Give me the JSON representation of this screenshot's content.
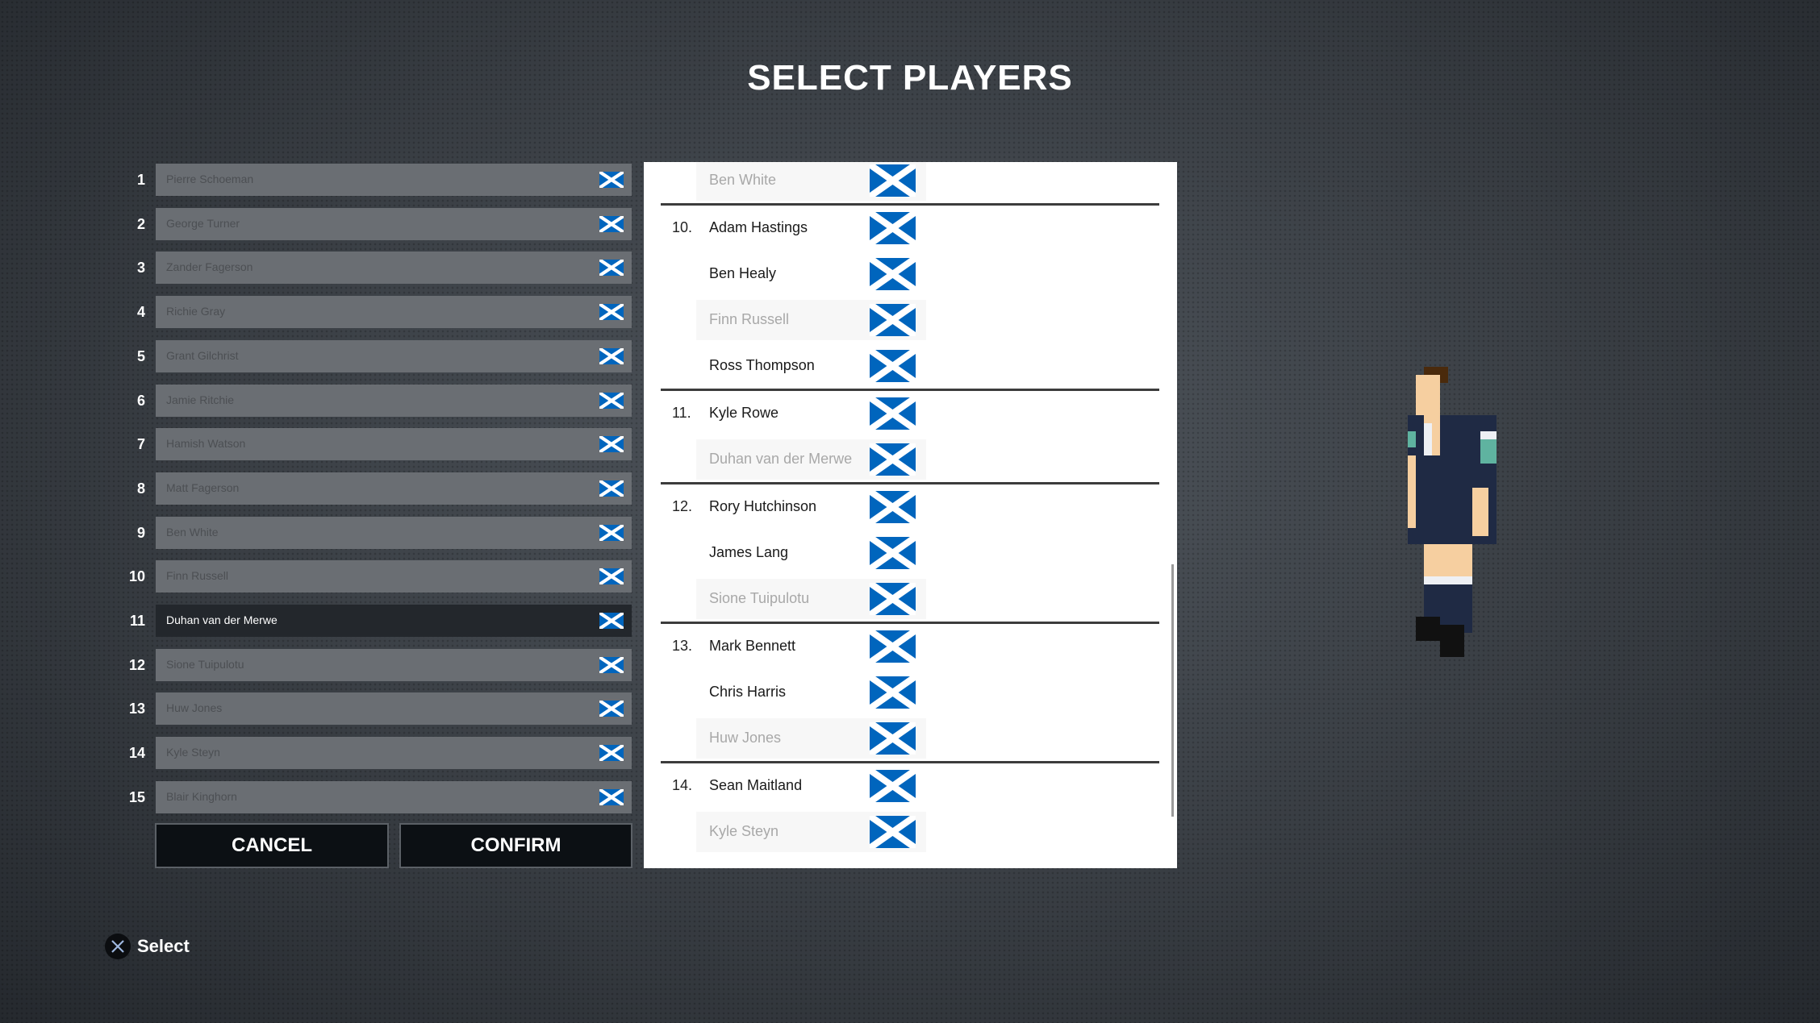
{
  "title": "SELECT PLAYERS",
  "colors": {
    "flag_blue": "#0065bd",
    "selected_slot": "#23272c",
    "slot": "#6a6e73"
  },
  "flag_icon": "scotland-saltire-flag",
  "slots": [
    {
      "number": "1",
      "name": "Pierre Schoeman",
      "selected": false
    },
    {
      "number": "2",
      "name": "George Turner",
      "selected": false
    },
    {
      "number": "3",
      "name": "Zander Fagerson",
      "selected": false
    },
    {
      "number": "4",
      "name": "Richie Gray",
      "selected": false
    },
    {
      "number": "5",
      "name": "Grant Gilchrist",
      "selected": false
    },
    {
      "number": "6",
      "name": "Jamie Ritchie",
      "selected": false
    },
    {
      "number": "7",
      "name": "Hamish Watson",
      "selected": false
    },
    {
      "number": "8",
      "name": "Matt Fagerson",
      "selected": false
    },
    {
      "number": "9",
      "name": "Ben White",
      "selected": false
    },
    {
      "number": "10",
      "name": "Finn Russell",
      "selected": false
    },
    {
      "number": "11",
      "name": "Duhan van der Merwe",
      "selected": true
    },
    {
      "number": "12",
      "name": "Sione Tuipulotu",
      "selected": false
    },
    {
      "number": "13",
      "name": "Huw Jones",
      "selected": false
    },
    {
      "number": "14",
      "name": "Kyle Steyn",
      "selected": false
    },
    {
      "number": "15",
      "name": "Blair Kinghorn",
      "selected": false
    }
  ],
  "buttons": {
    "cancel": "CANCEL",
    "confirm": "CONFIRM"
  },
  "groups": [
    {
      "number": "",
      "players": [
        {
          "name": "Ben White",
          "taken": true
        }
      ]
    },
    {
      "number": "10.",
      "players": [
        {
          "name": "Adam Hastings",
          "taken": false
        },
        {
          "name": "Ben Healy",
          "taken": false
        },
        {
          "name": "Finn Russell",
          "taken": true
        },
        {
          "name": "Ross Thompson",
          "taken": false
        }
      ]
    },
    {
      "number": "11.",
      "players": [
        {
          "name": "Kyle Rowe",
          "taken": false
        },
        {
          "name": "Duhan van der Merwe",
          "taken": true
        }
      ]
    },
    {
      "number": "12.",
      "players": [
        {
          "name": "Rory Hutchinson",
          "taken": false
        },
        {
          "name": "James Lang",
          "taken": false
        },
        {
          "name": "Sione Tuipulotu",
          "taken": true
        }
      ]
    },
    {
      "number": "13.",
      "players": [
        {
          "name": "Mark Bennett",
          "taken": false
        },
        {
          "name": "Chris Harris",
          "taken": false
        },
        {
          "name": "Huw Jones",
          "taken": true
        }
      ]
    },
    {
      "number": "14.",
      "players": [
        {
          "name": "Sean Maitland",
          "taken": false
        },
        {
          "name": "Kyle Steyn",
          "taken": true
        }
      ]
    }
  ],
  "hint": {
    "icon": "cross-button-icon",
    "label": "Select"
  }
}
